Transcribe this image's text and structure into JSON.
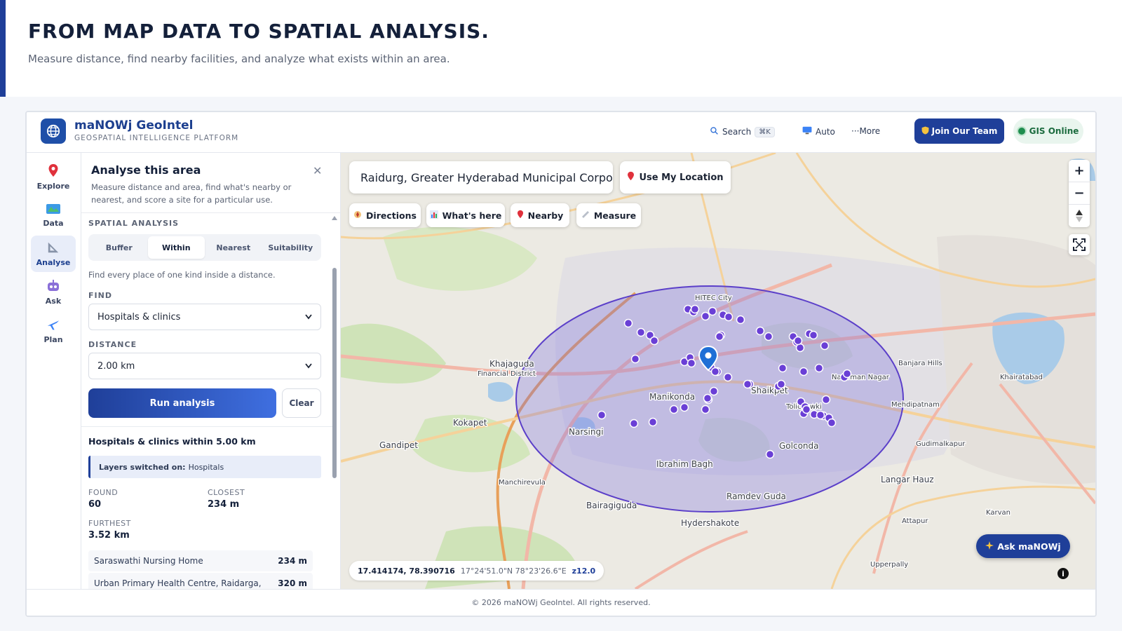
{
  "hero": {
    "title": "FROM MAP DATA TO SPATIAL ANALYSIS.",
    "subtitle": "Measure distance, find nearby facilities, and analyze what exists within an area."
  },
  "app": {
    "brand": "maNOWj GeoIntel",
    "tagline": "GEOSPATIAL INTELLIGENCE PLATFORM",
    "topbar": {
      "search_label": "Search",
      "search_shortcut": "⌘K",
      "theme_label": "Auto",
      "more_label": "···More",
      "join_label": "Join Our Team",
      "status_label": "GIS Online"
    },
    "rail": [
      {
        "label": "Explore",
        "icon": "pin-icon"
      },
      {
        "label": "Data",
        "icon": "map-icon"
      },
      {
        "label": "Analyse",
        "icon": "ruler-icon",
        "active": true
      },
      {
        "label": "Ask",
        "icon": "robot-icon"
      },
      {
        "label": "Plan",
        "icon": "plane-icon"
      }
    ],
    "panel": {
      "title": "Analyse this area",
      "description": "Measure distance and area, find what's nearby or nearest, and score a site for a particular use.",
      "section_label": "SPATIAL ANALYSIS",
      "tabs": [
        "Buffer",
        "Within",
        "Nearest",
        "Suitability"
      ],
      "active_tab": "Within",
      "hint": "Find every place of one kind inside a distance.",
      "find_label": "FIND",
      "find_value": "Hospitals & clinics",
      "distance_label": "DISTANCE",
      "distance_value": "2.00 km",
      "run_label": "Run analysis",
      "clear_label": "Clear",
      "results_title": "Hospitals & clinics within 5.00 km",
      "layers_prefix": "Layers switched on:",
      "layers_value": "Hospitals",
      "stats": {
        "found_label": "FOUND",
        "found_value": "60",
        "closest_label": "CLOSEST",
        "closest_value": "234 m",
        "furthest_label": "FURTHEST",
        "furthest_value": "3.52 km"
      },
      "results": [
        {
          "name": "Saraswathi Nursing Home",
          "distance": "234 m"
        },
        {
          "name": "Urban Primary Health Centre, Raidarga,",
          "distance": "320 m"
        }
      ]
    },
    "map": {
      "search_value": "Raidurg, Greater Hyderabad Municipal Corpora",
      "use_location_label": "Use My Location",
      "chips": [
        "Directions",
        "What's here",
        "Nearby",
        "Measure"
      ],
      "coords_decimal": "17.414174, 78.390716",
      "coords_dms": "17°24'51.0\"N 78°23'26.6\"E",
      "zoom": "z12.0",
      "ask_label": "Ask maNOWj",
      "place_labels": [
        "Khajaguda",
        "Manikonda",
        "Shaikpet",
        "Narsingi",
        "Golconda",
        "Ibrahim Bagh",
        "Langar Hauz",
        "Ramdev Guda",
        "Hydershakote",
        "Bairagiguda",
        "Kokapet",
        "Gandipet",
        "Manchirevula",
        "Financial District",
        "Tolichowki",
        "Mehdipatnam",
        "Gudimalkapur",
        "Attapur",
        "Karvan",
        "Upperpally",
        "Banjara Hills",
        "Khairatabad",
        "Navirman Nagar",
        "HITEC City"
      ],
      "colors": {
        "buffer_fill": "#7d6fe0",
        "buffer_stroke": "#5b3fc9",
        "poi": "#6a3fd6",
        "center_pin": "#1f6fd6"
      }
    },
    "footer": "© 2026 maNOWj GeoIntel. All rights reserved."
  }
}
